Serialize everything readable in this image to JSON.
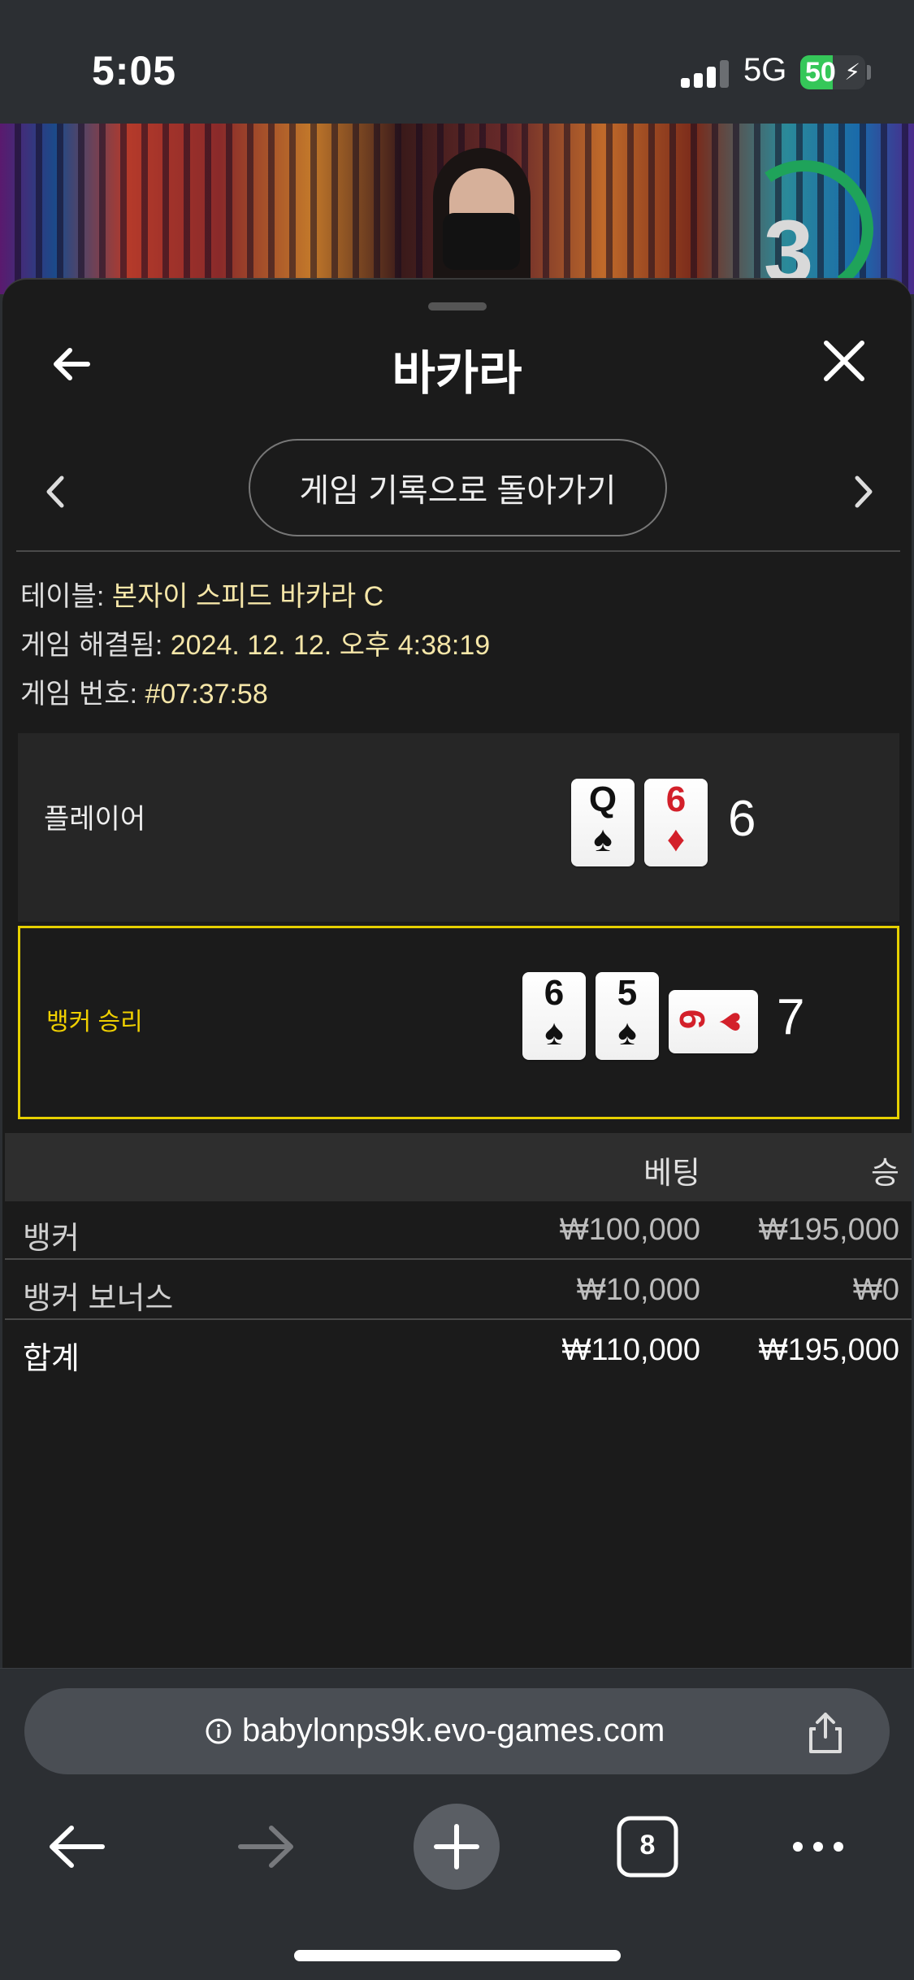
{
  "status_bar": {
    "time": "5:05",
    "network": "5G",
    "battery": "50",
    "battery_level": 0.5
  },
  "video": {
    "timer": "3"
  },
  "sheet": {
    "title": "바카라",
    "history_button": "게임 기록으로 돌아가기",
    "info": [
      {
        "label": "테이블: ",
        "value": "본자이 스피드 바카라 C"
      },
      {
        "label": "게임 해결됨: ",
        "value": "2024. 12. 12. 오후 4:38:19"
      },
      {
        "label": "게임 번호: ",
        "value": "#07:37:58"
      }
    ],
    "player": {
      "label": "플레이어",
      "score": "6",
      "cards": [
        {
          "rank": "Q",
          "suit": "♠",
          "color": "black"
        },
        {
          "rank": "6",
          "suit": "♦",
          "color": "red"
        }
      ]
    },
    "banker": {
      "label": "뱅커 승리",
      "score": "7",
      "cards": [
        {
          "rank": "6",
          "suit": "♠",
          "color": "black"
        },
        {
          "rank": "5",
          "suit": "♠",
          "color": "black"
        },
        {
          "rank": "6",
          "suit": "♥",
          "color": "red",
          "rotated": true
        }
      ]
    },
    "bets": {
      "headers": {
        "bet": "베팅",
        "win": "승"
      },
      "rows": [
        {
          "name": "뱅커",
          "bet": "₩100,000",
          "win": "₩195,000"
        },
        {
          "name": "뱅커 보너스",
          "bet": "₩10,000",
          "win": "₩0"
        }
      ],
      "total": {
        "name": "합계",
        "bet": "₩110,000",
        "win": "₩195,000"
      }
    }
  },
  "browser": {
    "url": "babylonps9k.evo-games.com",
    "tab_count": "8"
  },
  "colors": {
    "winner_border": "#e6d000",
    "winner_text": "#f0d000",
    "info_value": "#f5e6a8",
    "battery_green": "#35c759"
  }
}
